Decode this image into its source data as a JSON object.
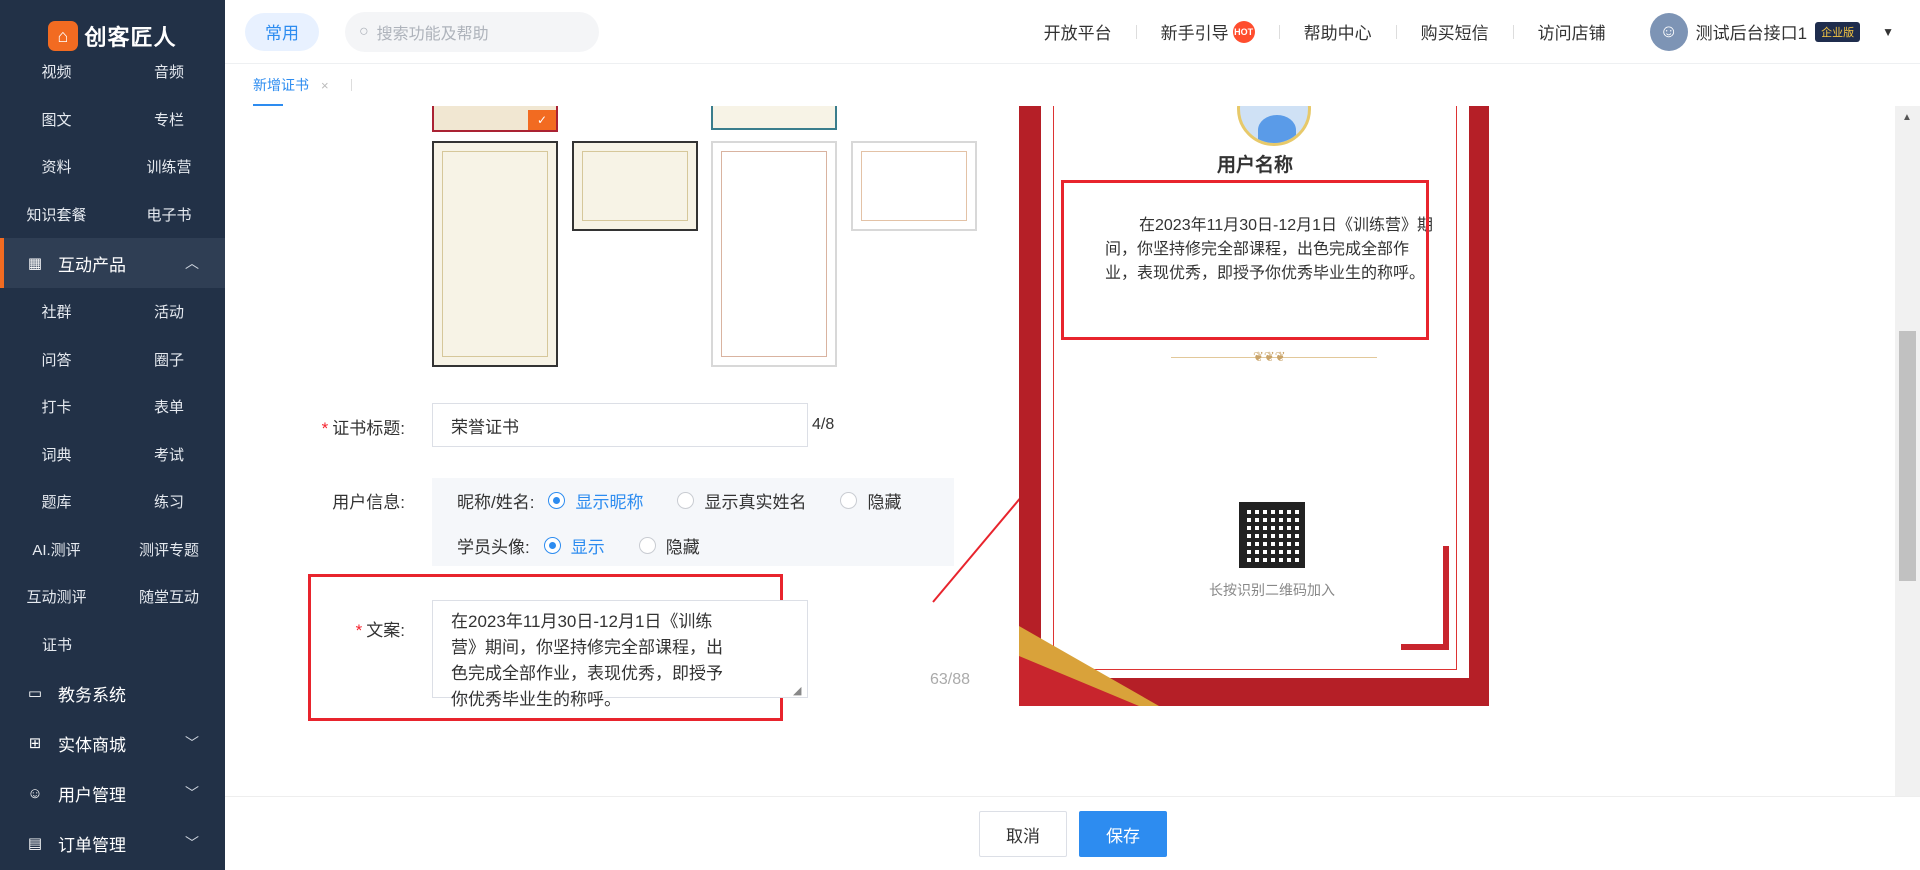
{
  "brand": {
    "name": "创客匠人"
  },
  "sidebar": {
    "grid_top": [
      "视频",
      "音频",
      "图文",
      "专栏",
      "资料",
      "训练营",
      "知识套餐",
      "电子书"
    ],
    "interactive": {
      "label": "互动产品"
    },
    "grid_interactive": [
      "社群",
      "活动",
      "问答",
      "圈子",
      "打卡",
      "表单",
      "词典",
      "考试",
      "题库",
      "练习",
      "AI.测评",
      "测评专题",
      "互动测评",
      "随堂互动"
    ],
    "single_item": "证书",
    "groups": [
      {
        "label": "教务系统"
      },
      {
        "label": "实体商城"
      },
      {
        "label": "用户管理"
      },
      {
        "label": "订单管理"
      }
    ]
  },
  "header": {
    "pill": "常用",
    "search_placeholder": "搜索功能及帮助",
    "nav": [
      "开放平台",
      "新手引导",
      "帮助中心",
      "购买短信",
      "访问店铺"
    ],
    "hot_badge": "HOT",
    "user_name": "测试后台接口1",
    "user_badge": "企业版"
  },
  "tabs": [
    {
      "label": "新增证书",
      "close": "×"
    }
  ],
  "form": {
    "title_label": "证书标题:",
    "title_value": "荣誉证书",
    "title_counter": "4/8",
    "userinfo_label": "用户信息:",
    "nickname_label": "昵称/姓名:",
    "nickname_options": [
      "显示昵称",
      "显示真实姓名",
      "隐藏"
    ],
    "avatar_label": "学员头像:",
    "avatar_options": [
      "显示",
      "隐藏"
    ],
    "copy_label": "文案:",
    "copy_value": "在2023年11月30日-12月1日《训练\n营》期间，你坚持修完全部课程，出\n色完成全部作业，表现优秀，即授予\n你优秀毕业生的称呼。",
    "copy_counter": "63/88"
  },
  "certificate": {
    "name": "用户名称",
    "text": "在2023年11月30日-12月1日《训练营》期间，你坚持修完全部课程，出色完成全部作业，表现优秀，即授予你优秀毕业生的称呼。",
    "qr_hint": "长按识别二维码加入"
  },
  "buttons": {
    "cancel": "取消",
    "save": "保存"
  },
  "colors": {
    "accent": "#2d8cf0",
    "brand": "#f26b21",
    "highlight_red": "#e8242d",
    "sidebar_bg": "#223147"
  }
}
